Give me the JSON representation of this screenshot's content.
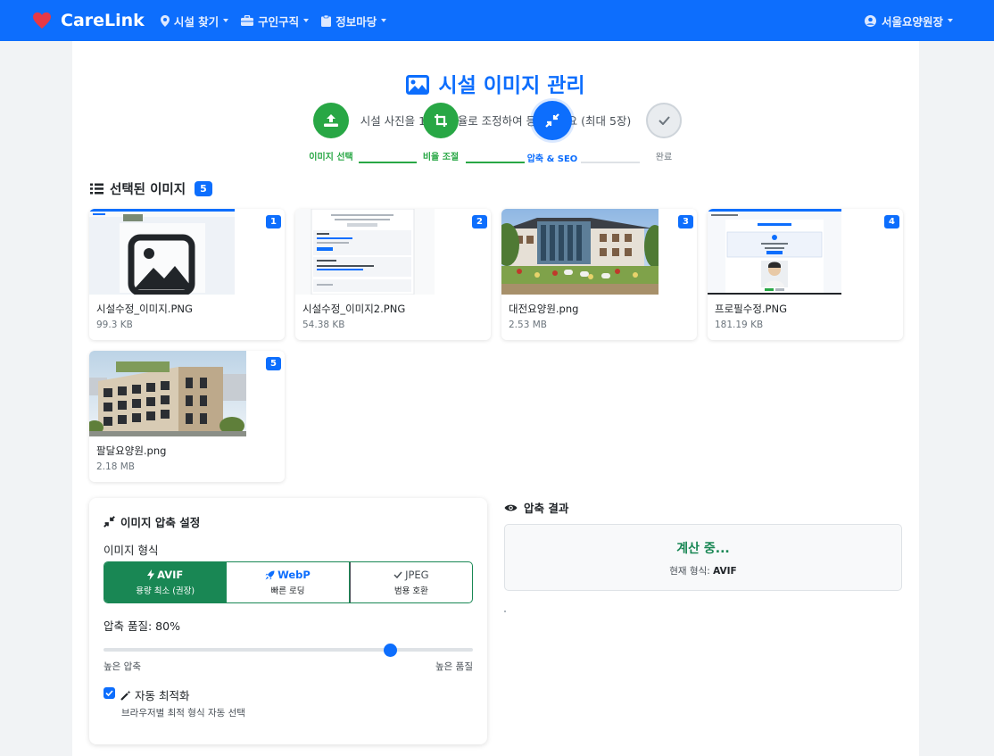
{
  "nav": {
    "brand": "CareLink",
    "items": [
      {
        "label": "시설 찾기",
        "icon": "map-marker-icon"
      },
      {
        "label": "구인구직",
        "icon": "briefcase-icon"
      },
      {
        "label": "정보마당",
        "icon": "clipboard-icon"
      }
    ],
    "user": "서울요양원장"
  },
  "page": {
    "title": "시설 이미지 관리",
    "subtitle": "시설 사진을 16:9 비율로 조정하여 등록하세요 (최대 5장)"
  },
  "steps": [
    {
      "label": "이미지 선택",
      "status": "done",
      "icon": "upload-icon"
    },
    {
      "label": "비율 조절",
      "status": "done",
      "icon": "crop-icon"
    },
    {
      "label": "압축 & SEO",
      "status": "active",
      "icon": "compress-icon"
    },
    {
      "label": "완료",
      "status": "pending",
      "icon": "check-icon"
    }
  ],
  "selected": {
    "title": "선택된 이미지",
    "count": "5",
    "images": [
      {
        "num": "1",
        "name": "시설수정_이미지.PNG",
        "size": "99.3 KB",
        "thumb": "screenshot-placeholder"
      },
      {
        "num": "2",
        "name": "시설수정_이미지2.PNG",
        "size": "54.38 KB",
        "thumb": "form-screenshot"
      },
      {
        "num": "3",
        "name": "대전요양원.png",
        "size": "2.53 MB",
        "thumb": "building-photo"
      },
      {
        "num": "4",
        "name": "프로필수정.PNG",
        "size": "181.19 KB",
        "thumb": "profile-screenshot"
      },
      {
        "num": "5",
        "name": "팔달요양원.png",
        "size": "2.18 MB",
        "thumb": "building-photo-2"
      }
    ]
  },
  "settings": {
    "title": "이미지 압축 설정",
    "format_label": "이미지 형식",
    "formats": [
      {
        "name": "AVIF",
        "desc": "용량 최소 (권장)",
        "selected": true
      },
      {
        "name": "WebP",
        "desc": "빠른 로딩",
        "selected": false
      },
      {
        "name": "JPEG",
        "desc": "범용 호환",
        "selected": false
      }
    ],
    "quality_label": "압축 품질: 80%",
    "quality": 80,
    "slider_min_label": "높은 압축",
    "slider_max_label": "높은 품질",
    "auto_label": "자동 최적화",
    "auto_checked": true,
    "auto_desc": "브라우저별 최적 형식 자동 선택"
  },
  "result": {
    "title": "압축 결과",
    "status": "계산 중...",
    "current_format_prefix": "현재 형식: ",
    "current_format": "AVIF"
  },
  "colors": {
    "primary": "#0d6efd",
    "success": "#28a745",
    "success_dark": "#198754",
    "brand_heart": "#e63946"
  }
}
